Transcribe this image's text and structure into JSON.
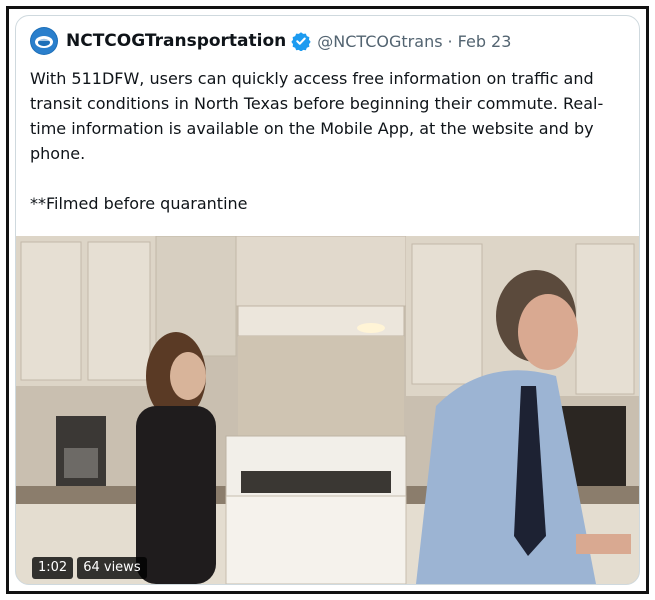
{
  "tweet": {
    "display_name": "NCTCOGTransportation",
    "handle": "@NCTCOGtrans",
    "separator": "·",
    "date": "Feb 23",
    "text_lines": [
      "With 511DFW, users can quickly access free information on traffic and",
      "transit conditions in North Texas before beginning their commute. Real-",
      "time information is available on the Mobile App, at the website and by",
      "phone."
    ],
    "note": "**Filmed before quarantine"
  },
  "video": {
    "duration": "1:02",
    "views": "64 views"
  },
  "colors": {
    "accent": "#1d9bf0",
    "text": "#0f1419",
    "muted": "#536471",
    "border": "#cfd9de"
  },
  "icons": {
    "avatar": "account-logo",
    "verified": "verified-badge"
  }
}
